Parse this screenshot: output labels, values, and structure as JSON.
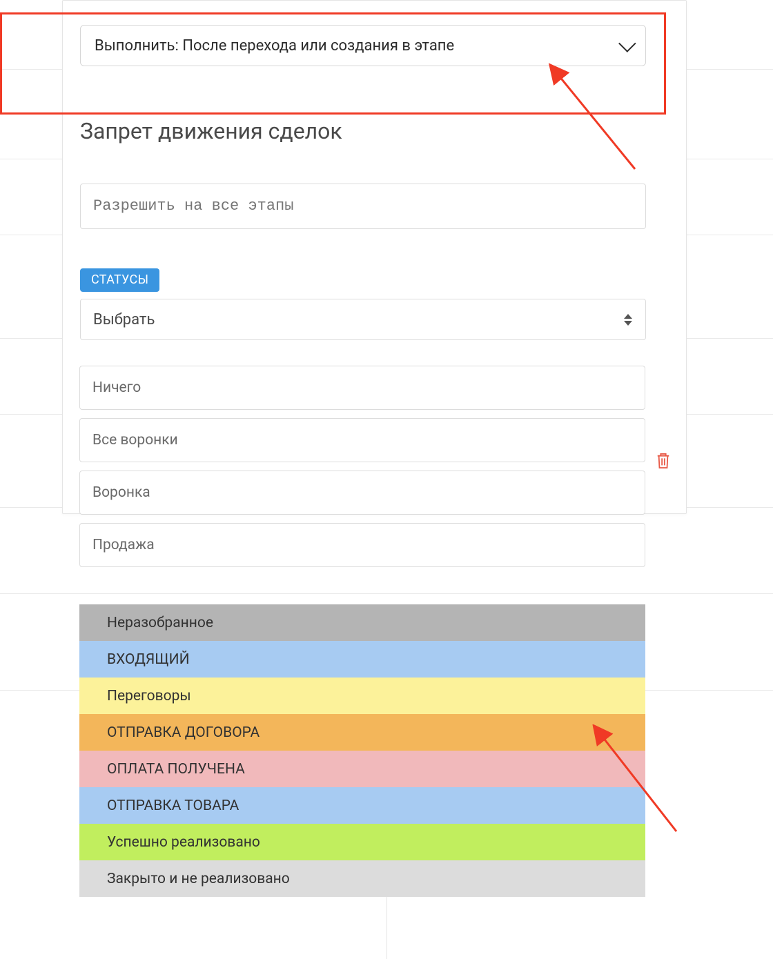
{
  "trigger": {
    "label": "Выполнить: После перехода или создания в этапе"
  },
  "section_title": "Запрет движения сделок",
  "allow_input": {
    "placeholder": "Разрешить на все этапы"
  },
  "status": {
    "badge": "СТАТУСЫ",
    "placeholder": "Выбрать"
  },
  "options": [
    "Ничего",
    "Все воронки",
    "Воронка",
    "Продажа"
  ],
  "stages": [
    {
      "label": "Неразобранное",
      "color": "#b4b4b4"
    },
    {
      "label": "ВХОДЯЩИЙ",
      "color": "#a7cbf2"
    },
    {
      "label": "Переговоры",
      "color": "#fcf29a"
    },
    {
      "label": "ОТПРАВКА ДОГОВОРА",
      "color": "#f3b65a"
    },
    {
      "label": "ОПЛАТА ПОЛУЧЕНА",
      "color": "#f1b9bb"
    },
    {
      "label": "ОТПРАВКА ТОВАРА",
      "color": "#a7cbf2"
    },
    {
      "label": "Успешно реализовано",
      "color": "#c1ee5e"
    },
    {
      "label": "Закрыто и не реализовано",
      "color": "#dcdcdc"
    }
  ],
  "annotations": {
    "arrow1_color": "#f03a25",
    "arrow2_color": "#f03a25",
    "highlight_color": "#f03a25"
  }
}
